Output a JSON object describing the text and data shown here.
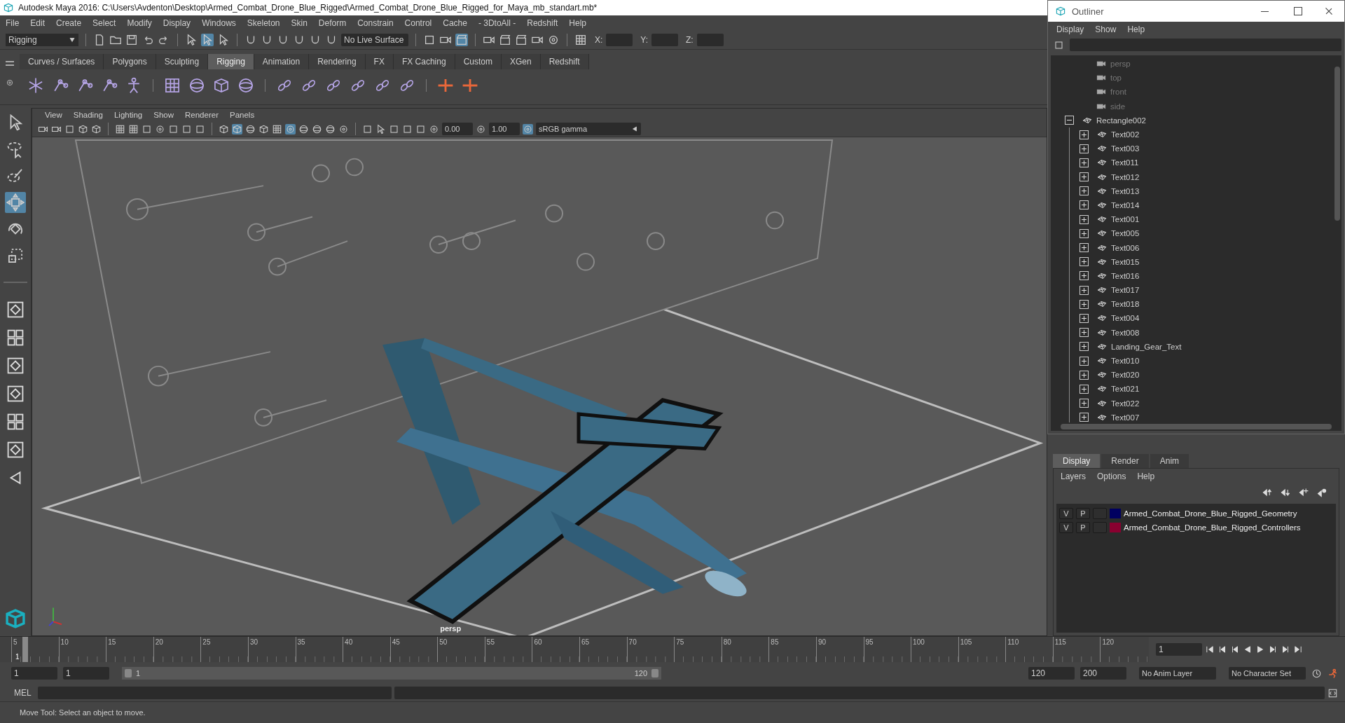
{
  "window": {
    "title": "Autodesk Maya 2016: C:\\Users\\Avdenton\\Desktop\\Armed_Combat_Drone_Blue_Rigged\\Armed_Combat_Drone_Blue_Rigged_for_Maya_mb_standart.mb*"
  },
  "menu_bar": [
    "File",
    "Edit",
    "Create",
    "Select",
    "Modify",
    "Display",
    "Windows",
    "Skeleton",
    "Skin",
    "Deform",
    "Constrain",
    "Control",
    "Cache",
    "- 3DtoAll -",
    "Redshift",
    "Help"
  ],
  "status_line": {
    "menu_set": "Rigging",
    "live_surface": "No Live Surface",
    "coords": [
      "X:",
      "Y:",
      "Z:"
    ]
  },
  "shelf_tabs": [
    {
      "label": "Curves / Surfaces",
      "selected": false
    },
    {
      "label": "Polygons",
      "selected": false
    },
    {
      "label": "Sculpting",
      "selected": false
    },
    {
      "label": "Rigging",
      "selected": true
    },
    {
      "label": "Animation",
      "selected": false
    },
    {
      "label": "Rendering",
      "selected": false
    },
    {
      "label": "FX",
      "selected": false
    },
    {
      "label": "FX Caching",
      "selected": false
    },
    {
      "label": "Custom",
      "selected": false
    },
    {
      "label": "XGen",
      "selected": false
    },
    {
      "label": "Redshift",
      "selected": false
    }
  ],
  "tools": [
    {
      "kind": "select",
      "selected": false
    },
    {
      "kind": "lasso",
      "selected": false
    },
    {
      "kind": "paint",
      "selected": false
    },
    {
      "kind": "move",
      "selected": true
    },
    {
      "kind": "rotate",
      "selected": false
    },
    {
      "kind": "scale",
      "selected": false
    }
  ],
  "viewport": {
    "menus": [
      "View",
      "Shading",
      "Lighting",
      "Show",
      "Renderer",
      "Panels"
    ],
    "exposure": "0.00",
    "gamma": "1.00",
    "color_space": "sRGB gamma",
    "camera_label": "persp"
  },
  "outliner": {
    "title": "Outliner",
    "menus": [
      "Display",
      "Show",
      "Help"
    ],
    "items": [
      {
        "name": "persp",
        "kind": "camera"
      },
      {
        "name": "top",
        "kind": "camera"
      },
      {
        "name": "front",
        "kind": "camera"
      },
      {
        "name": "side",
        "kind": "camera"
      },
      {
        "name": "Rectangle002",
        "kind": "mesh",
        "expanded": true,
        "children": [
          {
            "name": "Text002",
            "kind": "mesh",
            "expanded": false
          },
          {
            "name": "Text003",
            "kind": "mesh",
            "expanded": false
          },
          {
            "name": "Text011",
            "kind": "mesh",
            "expanded": false
          },
          {
            "name": "Text012",
            "kind": "mesh",
            "expanded": false
          },
          {
            "name": "Text013",
            "kind": "mesh",
            "expanded": false
          },
          {
            "name": "Text014",
            "kind": "mesh",
            "expanded": false
          },
          {
            "name": "Text001",
            "kind": "mesh",
            "expanded": false
          },
          {
            "name": "Text005",
            "kind": "mesh",
            "expanded": false
          },
          {
            "name": "Text006",
            "kind": "mesh",
            "expanded": false
          },
          {
            "name": "Text015",
            "kind": "mesh",
            "expanded": false
          },
          {
            "name": "Text016",
            "kind": "mesh",
            "expanded": false
          },
          {
            "name": "Text017",
            "kind": "mesh",
            "expanded": false
          },
          {
            "name": "Text018",
            "kind": "mesh",
            "expanded": false
          },
          {
            "name": "Text004",
            "kind": "mesh",
            "expanded": false
          },
          {
            "name": "Text008",
            "kind": "mesh",
            "expanded": false
          },
          {
            "name": "Landing_Gear_Text",
            "kind": "mesh",
            "expanded": false
          },
          {
            "name": "Text010",
            "kind": "mesh",
            "expanded": false
          },
          {
            "name": "Text020",
            "kind": "mesh",
            "expanded": false
          },
          {
            "name": "Text021",
            "kind": "mesh",
            "expanded": false
          },
          {
            "name": "Text022",
            "kind": "mesh",
            "expanded": false
          },
          {
            "name": "Text007",
            "kind": "mesh",
            "expanded": false
          }
        ]
      }
    ]
  },
  "layer_editor": {
    "tabs": [
      {
        "label": "Display",
        "selected": true
      },
      {
        "label": "Render",
        "selected": false
      },
      {
        "label": "Anim",
        "selected": false
      }
    ],
    "menus": [
      "Layers",
      "Options",
      "Help"
    ],
    "layers": [
      {
        "visibility": "V",
        "playback": "P",
        "name": "Armed_Combat_Drone_Blue_Rigged_Geometry",
        "color": "#000060"
      },
      {
        "visibility": "V",
        "playback": "P",
        "name": "Armed_Combat_Drone_Blue_Rigged_Controllers",
        "color": "#8a0030"
      }
    ]
  },
  "time_slider": {
    "ticks": [
      "5",
      "10",
      "15",
      "20",
      "25",
      "30",
      "35",
      "40",
      "45",
      "50",
      "55",
      "60",
      "65",
      "70",
      "75",
      "80",
      "85",
      "90",
      "95",
      "100",
      "105",
      "110",
      "115",
      "120"
    ],
    "frame_marker": "1",
    "level": 0.01,
    "current_frame": "1"
  },
  "range_slider": {
    "start_time": "1",
    "playback_start": "1",
    "range_start": "1",
    "range_end": "120",
    "level": 1,
    "playback_end": "120",
    "end_time": "200",
    "anim_layer": "No Anim Layer",
    "character_set": "No Character Set"
  },
  "command_line": {
    "language": "MEL"
  },
  "help_line": "Move Tool: Select an object to move."
}
